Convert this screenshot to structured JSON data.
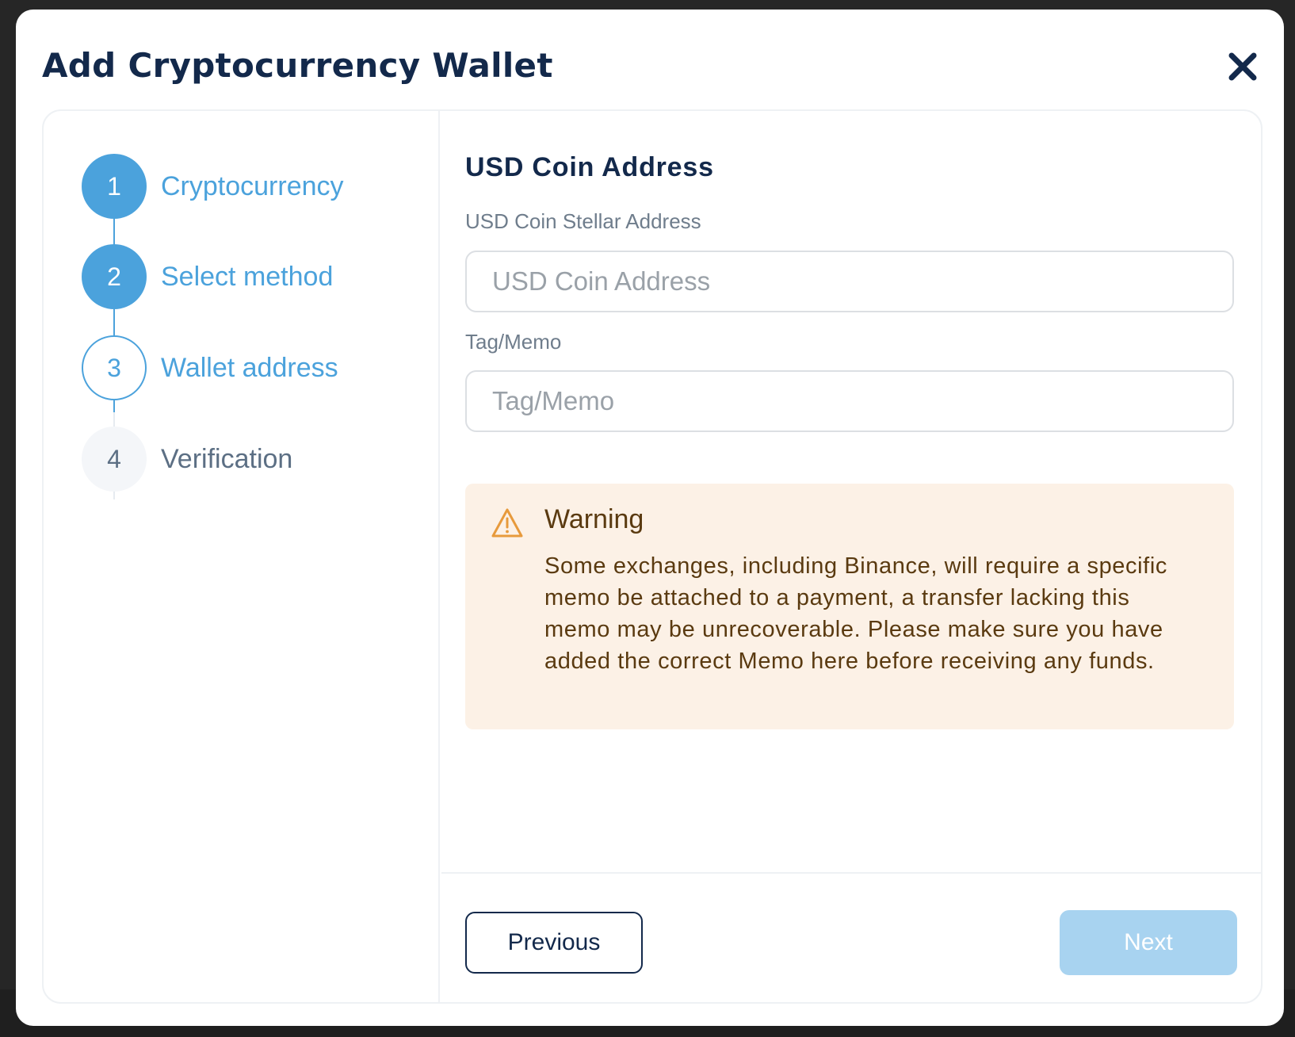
{
  "modal": {
    "title": "Add Cryptocurrency Wallet",
    "close_icon": "close-icon"
  },
  "stepper": {
    "steps": [
      {
        "number": "1",
        "label": "Cryptocurrency",
        "state": "completed"
      },
      {
        "number": "2",
        "label": "Select method",
        "state": "completed"
      },
      {
        "number": "3",
        "label": "Wallet address",
        "state": "current"
      },
      {
        "number": "4",
        "label": "Verification",
        "state": "pending"
      }
    ]
  },
  "form": {
    "section_title": "USD Coin Address",
    "address_label": "USD Coin Stellar Address",
    "address_placeholder": "USD Coin Address",
    "address_value": "",
    "memo_label": "Tag/Memo",
    "memo_placeholder": "Tag/Memo",
    "memo_value": ""
  },
  "warning": {
    "icon": "warning-triangle-icon",
    "title": "Warning",
    "text": "Some exchanges, including Binance, will require a specific memo be attached to a payment, a transfer lacking this memo may be unrecoverable. Please make sure you have added the correct Memo here before receiving any funds."
  },
  "footer": {
    "previous_label": "Previous",
    "next_label": "Next"
  },
  "colors": {
    "accent": "#4ba2dc",
    "title": "#13294b",
    "warning_bg": "#fcf1e6",
    "warning_icon": "#e79a3c",
    "next_disabled": "#a8d3f0"
  }
}
